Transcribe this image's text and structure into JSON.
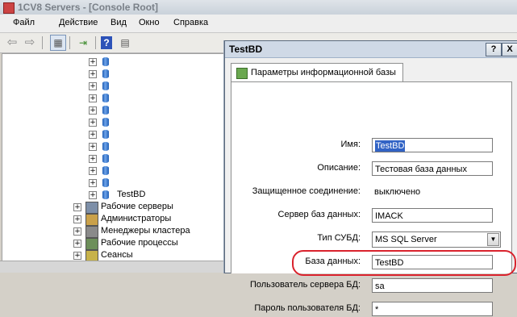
{
  "mmc": {
    "title": "1CV8 Servers - [Console Root]",
    "menu": [
      "Файл",
      "Действие",
      "Вид",
      "Окно",
      "Справка"
    ],
    "toolbar_icons": [
      "back-arrow-icon",
      "forward-arrow-icon",
      "show-tree-icon",
      "export-icon",
      "help-icon",
      "properties-icon"
    ]
  },
  "tree": {
    "db_rows": [
      "",
      "",
      "",
      "",
      "",
      "",
      "",
      "",
      "",
      "",
      ""
    ],
    "selected_db": "TestBD",
    "groups": [
      "Рабочие серверы",
      "Администраторы",
      "Менеджеры кластера",
      "Рабочие процессы",
      "Сеансы"
    ]
  },
  "dialog": {
    "title": "TestBD",
    "help_btn": "?",
    "close_btn": "X",
    "tab_label": "Параметры информационной базы",
    "fields": {
      "name": {
        "label": "Имя:",
        "value": "TestBD"
      },
      "description": {
        "label": "Описание:",
        "value": "Тестовая база данных"
      },
      "secure": {
        "label": "Защищенное соединение:",
        "value": "выключено"
      },
      "db_server": {
        "label": "Сервер баз данных:",
        "value": "IMACK"
      },
      "dbms_type": {
        "label": "Тип СУБД:",
        "value": "MS SQL Server"
      },
      "database": {
        "label": "База данных:",
        "value": "TestBD"
      },
      "db_user": {
        "label": "Пользователь сервера БД:",
        "value": "sa"
      },
      "db_password": {
        "label": "Пароль пользователя БД:",
        "value": "*"
      }
    }
  },
  "colors": {
    "highlight": "#d9232d",
    "selection": "#3163c5"
  }
}
